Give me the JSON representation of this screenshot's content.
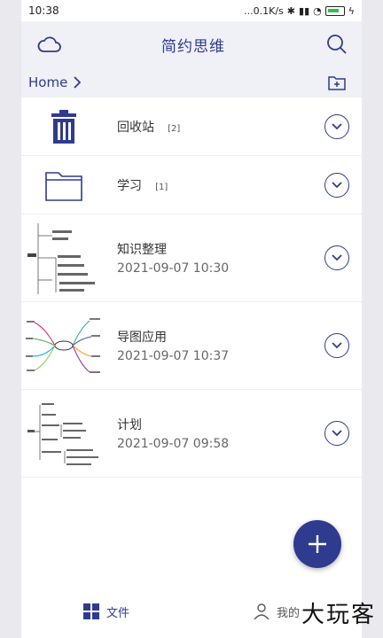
{
  "status": {
    "time": "10:38",
    "network": "...0.1K/s",
    "battery_icon": "battery-icon"
  },
  "appbar": {
    "title": "简约思维"
  },
  "breadcrumb": {
    "home": "Home"
  },
  "items": [
    {
      "type": "trash",
      "name": "回收站",
      "count": "[2]"
    },
    {
      "type": "folder",
      "name": "学习",
      "count": "[1]"
    },
    {
      "type": "file",
      "name": "知识整理",
      "date": "2021-09-07 10:30"
    },
    {
      "type": "file",
      "name": "导图应用",
      "date": "2021-09-07 10:37"
    },
    {
      "type": "file",
      "name": "计划",
      "date": "2021-09-07 09:58"
    }
  ],
  "tabs": {
    "files": "文件",
    "mine": "我的"
  },
  "watermark": "大玩客",
  "colors": {
    "accent": "#2f3b8f",
    "bar_bg": "#f0f0f7"
  }
}
